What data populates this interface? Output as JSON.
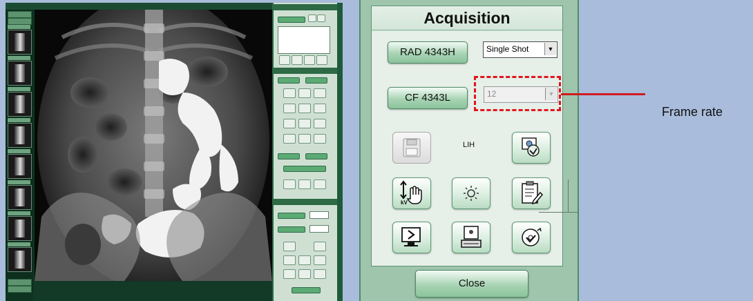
{
  "acquisition": {
    "title": "Acquisition",
    "rad_button": "RAD 4343H",
    "rad_mode": "Single Shot",
    "cf_button": "CF 4343L",
    "frame_rate_value": "12",
    "lih_label": "LIH",
    "close_button": "Close",
    "icons": [
      "save-icon",
      "image-export-icon",
      "kv-hand-icon",
      "brightness-icon",
      "notes-edit-icon",
      "monitor-arrow-icon",
      "workstation-icon",
      "cd-burn-icon"
    ]
  },
  "callout": {
    "label": "Frame rate",
    "color": "#e0161c"
  },
  "colors": {
    "panel_green": "#9fc5ad",
    "button_green": "#a8d4b4",
    "background": "#a9bcdc"
  }
}
